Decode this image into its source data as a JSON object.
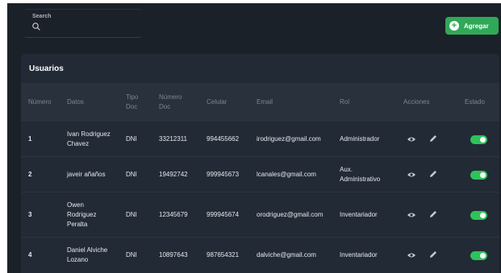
{
  "search": {
    "label": "Search",
    "value": "",
    "placeholder": ""
  },
  "toolbar": {
    "add_label": "Agregar"
  },
  "card": {
    "title": "Usuarios"
  },
  "table": {
    "headers": {
      "numero": "Número",
      "datos": "Datos",
      "tipo_doc_1": "Tipo",
      "tipo_doc_2": "Doc",
      "numero_doc_1": "Número",
      "numero_doc_2": "Doc",
      "celular": "Celular",
      "email": "Email",
      "rol": "Rol",
      "acciones": "Acciones",
      "estado": "Estado"
    },
    "rows": [
      {
        "num": "1",
        "datos": [
          "Ivan Rodriguez",
          "Chavez"
        ],
        "tipo": "DNI",
        "doc": "33212311",
        "cel": "994455662",
        "email": "irodriguez@gmail.com",
        "rol": [
          "Administrador"
        ],
        "estado": true
      },
      {
        "num": "2",
        "datos": [
          "javeir añaños"
        ],
        "tipo": "DNI",
        "doc": "19492742",
        "cel": "999945673",
        "email": "lcanales@gmail.com",
        "rol": [
          "Aux.",
          "Administrativo"
        ],
        "estado": true
      },
      {
        "num": "3",
        "datos": [
          "Owen",
          "Rodriguez",
          "Peralta"
        ],
        "tipo": "DNI",
        "doc": "12345679",
        "cel": "999945674",
        "email": "orodriguez@gmail.com",
        "rol": [
          "Inventariador"
        ],
        "estado": true
      },
      {
        "num": "4",
        "datos": [
          "Daniel Alviche",
          "Lozano"
        ],
        "tipo": "DNI",
        "doc": "10897643",
        "cel": "987654321",
        "email": "dalviche@gmail.com",
        "rol": [
          "Inventariador"
        ],
        "estado": true
      }
    ]
  },
  "colors": {
    "background": "#1b2129",
    "card": "#222a35",
    "header": "#29313d",
    "accent": "#2fa957",
    "toggle_on": "#2fc25a"
  },
  "icons": {
    "search": "search-icon",
    "add": "plus-circle-icon",
    "view": "eye-icon",
    "edit": "pencil-icon"
  }
}
